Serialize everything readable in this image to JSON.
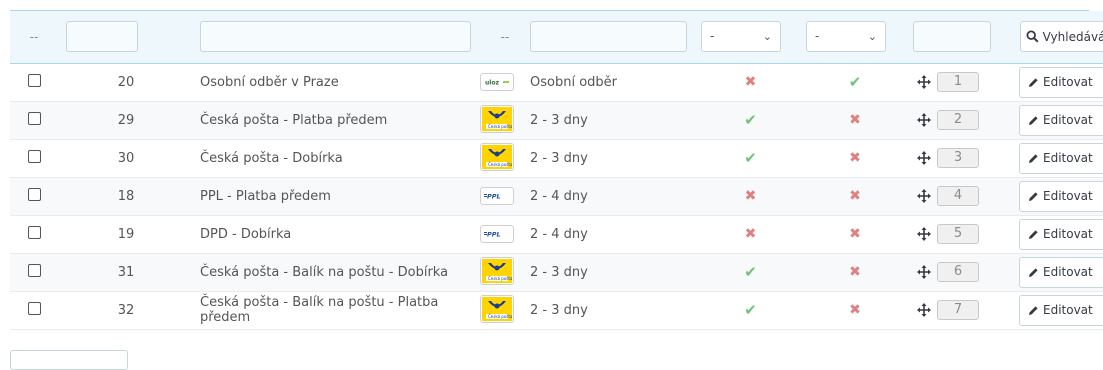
{
  "filters": {
    "placeholder": "--",
    "delivery_placeholder": "--",
    "select_free": "-",
    "select_default": "-",
    "search_button": "Vyhledávání"
  },
  "rows": [
    {
      "id": "20",
      "name": "Osobní odběr v Praze",
      "logo": "ulozenka-logo",
      "delay": "Osobní odběr",
      "free": "no",
      "default": "yes",
      "position": "1",
      "edit": "Editovat"
    },
    {
      "id": "29",
      "name": "Česká pošta - Platba předem",
      "logo": "ceska-posta-logo",
      "delay": "2 - 3 dny",
      "free": "yes",
      "default": "no",
      "position": "2",
      "edit": "Editovat"
    },
    {
      "id": "30",
      "name": "Česká pošta - Dobírka",
      "logo": "ceska-posta-logo",
      "delay": "2 - 3 dny",
      "free": "yes",
      "default": "no",
      "position": "3",
      "edit": "Editovat"
    },
    {
      "id": "18",
      "name": "PPL - Platba předem",
      "logo": "ppl-logo",
      "delay": "2 - 4 dny",
      "free": "no",
      "default": "no",
      "position": "4",
      "edit": "Editovat"
    },
    {
      "id": "19",
      "name": "DPD - Dobírka",
      "logo": "ppl-logo",
      "delay": "2 - 4 dny",
      "free": "no",
      "default": "no",
      "position": "5",
      "edit": "Editovat"
    },
    {
      "id": "31",
      "name": "Česká pošta - Balík na poštu - Dobírka",
      "logo": "ceska-posta-logo",
      "delay": "2 - 3 dny",
      "free": "yes",
      "default": "no",
      "position": "6",
      "edit": "Editovat"
    },
    {
      "id": "32",
      "name": "Česká pošta - Balík na poštu - Platba předem",
      "logo": "ceska-posta-logo",
      "delay": "2 - 3 dny",
      "free": "yes",
      "default": "no",
      "position": "7",
      "edit": "Editovat"
    }
  ],
  "colors": {
    "accent_border": "#a9d6ea",
    "filter_bg": "#eef7fb",
    "check_green": "#72c279",
    "cross_red": "#e08080"
  }
}
